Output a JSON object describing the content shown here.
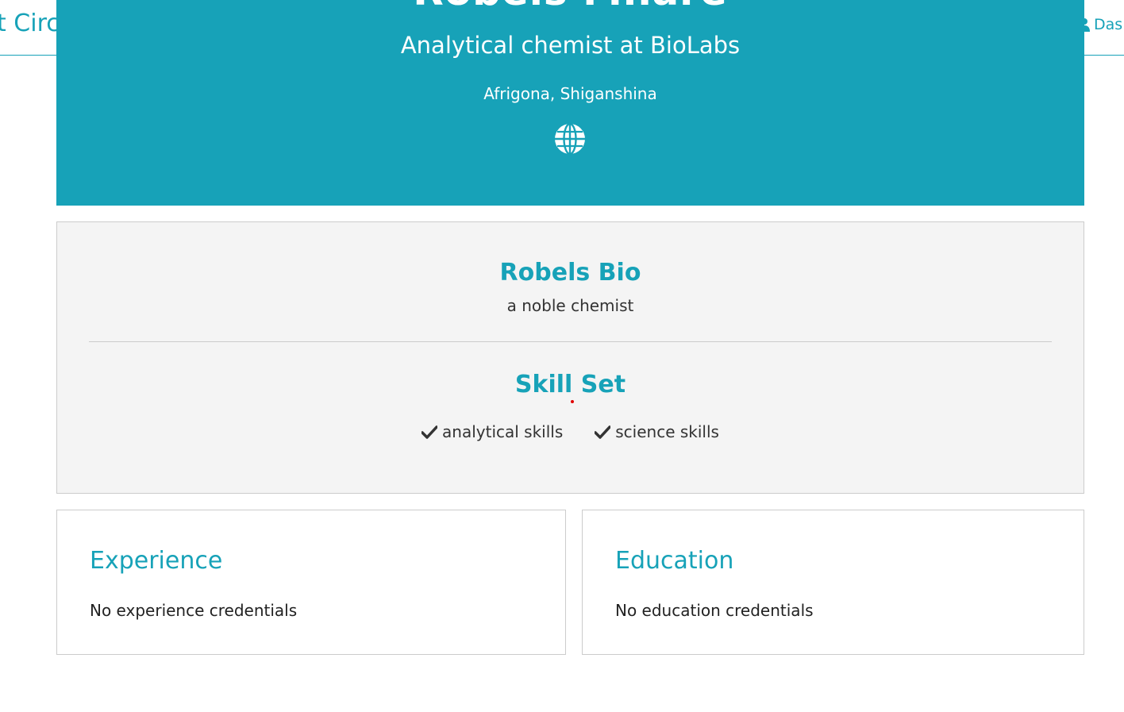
{
  "navbar": {
    "brand": "t Circ",
    "dashboard_label": "Das",
    "user_icon": "user-icon"
  },
  "profile": {
    "name": "Robels Mhare",
    "title": "Analytical chemist at BioLabs",
    "location": "Afrigona, Shiganshina",
    "website_icon": "globe-icon"
  },
  "about": {
    "bio_heading": "Robels Bio",
    "bio_text": "a noble chemist",
    "skills_heading": "Skill Set",
    "skills": [
      {
        "label": "analytical skills",
        "icon": "check-icon"
      },
      {
        "label": "science skills",
        "icon": "check-icon"
      }
    ]
  },
  "experience": {
    "heading": "Experience",
    "empty_text": "No experience credentials"
  },
  "education": {
    "heading": "Education",
    "empty_text": "No education credentials"
  },
  "colors": {
    "accent": "#17a2b8",
    "panel_bg": "#f4f4f4",
    "border": "#cccccc",
    "text": "#333333"
  }
}
